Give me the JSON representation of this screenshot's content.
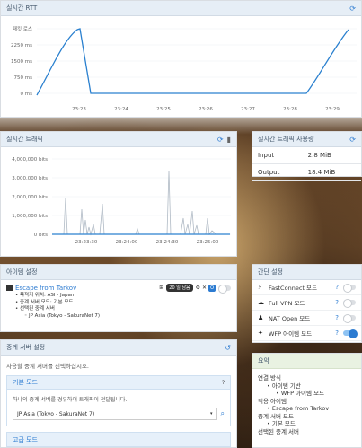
{
  "rtt": {
    "title": "실시간 RTT",
    "y_ticks": [
      "0 ms",
      "750 ms",
      "1500 ms",
      "2250 ms",
      "패킷 로스"
    ],
    "x_ticks": [
      "23:23",
      "23:24",
      "23:25",
      "23:26",
      "23:27",
      "23:28",
      "23:29"
    ]
  },
  "traffic": {
    "title": "실시간 트래픽",
    "y_ticks": [
      "0 bits",
      "1,000,000 bits",
      "2,000,000 bits",
      "3,000,000 bits",
      "4,000,000 bits"
    ],
    "x_ticks": [
      "23:23:30",
      "23:24:00",
      "23:24:30",
      "23:25:00"
    ]
  },
  "usage": {
    "title": "실시간 트래픽 사용량",
    "rows": [
      {
        "label": "Input",
        "value": "2.8 MiB"
      },
      {
        "label": "Output",
        "value": "18.4 MiB"
      }
    ]
  },
  "item_settings": {
    "title": "아이템 설정",
    "item_name": "Escape from Tarkov",
    "badge": "20 일 남음",
    "lines": [
      "• 목적지 위치: ASI - Japan",
      "• 중계 서버 모드: 기본 모드",
      "• 선택된 중계 서버"
    ],
    "server": "JP Asia (Tokyo - SakuraNet 7)"
  },
  "quick_settings": {
    "title": "간단 설정",
    "rows": [
      {
        "icon": "⚡",
        "label": "FastConnect 모드",
        "on": false
      },
      {
        "icon": "☁",
        "label": "Full VPN 모드",
        "on": false
      },
      {
        "icon": "♟",
        "label": "NAT Open 모드",
        "on": false
      },
      {
        "icon": "✦",
        "label": "WFP 아이템 모드",
        "on": true
      }
    ]
  },
  "relay": {
    "title": "중계 서버 설정",
    "desc": "사용할 중계 서버를 선택하십시오.",
    "basic_title": "기본 모드",
    "basic_desc": "하나의 중계 서버를 경유하여 트래픽이 전달됩니다.",
    "select_value": "JP Asia (Tokyo - SakuraNet 7)",
    "advanced_title": "고급 모드"
  },
  "summary": {
    "title": "요약",
    "sections": [
      {
        "head": "연결 방식",
        "items": [
          "아이템 기반"
        ],
        "subs": [
          "WFP 아이템 모드"
        ]
      },
      {
        "head": "적용 아이템",
        "items": [
          "Escape from Tarkov"
        ],
        "subs": []
      },
      {
        "head": "중계 서버 모드",
        "items": [
          "기본 모드"
        ],
        "subs": []
      },
      {
        "head": "선택된 중계 서버",
        "items": [],
        "subs": []
      }
    ]
  },
  "colors": {
    "accent": "#2c7bd1",
    "header_bg": "#e6eef6",
    "line": "#2a80cf"
  }
}
